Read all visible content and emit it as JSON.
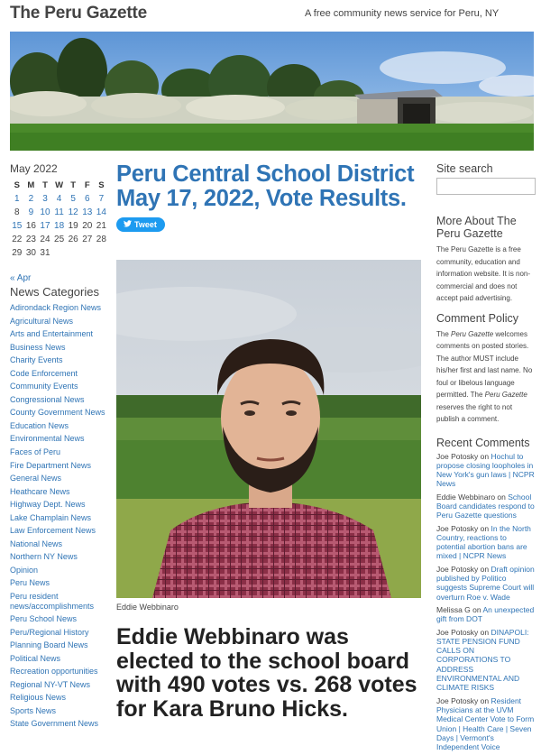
{
  "site": {
    "title": "The Peru Gazette",
    "tagline": "A free community news service for Peru, NY"
  },
  "calendar": {
    "title": "May 2022",
    "weekdays": [
      "S",
      "M",
      "T",
      "W",
      "T",
      "F",
      "S"
    ],
    "weeks": [
      [
        {
          "d": "1",
          "link": true
        },
        {
          "d": "2",
          "link": true
        },
        {
          "d": "3",
          "link": true
        },
        {
          "d": "4",
          "link": true
        },
        {
          "d": "5",
          "link": true
        },
        {
          "d": "6",
          "link": true
        },
        {
          "d": "7",
          "link": true
        }
      ],
      [
        {
          "d": "8",
          "link": false
        },
        {
          "d": "9",
          "link": true
        },
        {
          "d": "10",
          "link": true
        },
        {
          "d": "11",
          "link": true
        },
        {
          "d": "12",
          "link": true
        },
        {
          "d": "13",
          "link": true
        },
        {
          "d": "14",
          "link": true
        }
      ],
      [
        {
          "d": "15",
          "link": true
        },
        {
          "d": "16",
          "link": false
        },
        {
          "d": "17",
          "link": true
        },
        {
          "d": "18",
          "link": true
        },
        {
          "d": "19",
          "link": false
        },
        {
          "d": "20",
          "link": false
        },
        {
          "d": "21",
          "link": false
        }
      ],
      [
        {
          "d": "22",
          "link": false
        },
        {
          "d": "23",
          "link": false
        },
        {
          "d": "24",
          "link": false
        },
        {
          "d": "25",
          "link": false
        },
        {
          "d": "26",
          "link": false
        },
        {
          "d": "27",
          "link": false
        },
        {
          "d": "28",
          "link": false
        }
      ],
      [
        {
          "d": "29",
          "link": false
        },
        {
          "d": "30",
          "link": false
        },
        {
          "d": "31",
          "link": false
        },
        {
          "d": "",
          "link": false
        },
        {
          "d": "",
          "link": false
        },
        {
          "d": "",
          "link": false
        },
        {
          "d": "",
          "link": false
        }
      ]
    ],
    "prev_link": "« Apr"
  },
  "categories": {
    "title": "News Categories",
    "items": [
      "Adirondack Region News",
      "Agricultural News",
      "Arts and Entertainment",
      "Business News",
      "Charity Events",
      "Code Enforcement",
      "Community Events",
      "Congressional News",
      "County Government News",
      "Education News",
      "Environmental News",
      "Faces of Peru",
      "Fire Department News",
      "General News",
      "Heathcare News",
      "Highway Dept. News",
      "Lake Champlain News",
      "Law Enforcement News",
      "National News",
      "Northern NY News",
      "Opinion",
      "Peru News",
      "Peru resident news/accomplishments",
      "Peru School News",
      "Peru/Regional History",
      "Planning Board News",
      "Political News",
      "Recreation opportunities",
      "Regional NY-VT News",
      "Religious News",
      "Sports News",
      "State Government News"
    ]
  },
  "post": {
    "title": "Peru Central School District May 17, 2022, Vote Results.",
    "tweet_label": "Tweet",
    "photo_caption": "Eddie Webbinaro",
    "headline": "Eddie Webbinaro was elected to the school board with 490 votes vs. 268 votes for Kara Bruno Hicks."
  },
  "sidebar": {
    "search_title": "Site search",
    "search_placeholder": "",
    "about_title": "More About The Peru Gazette",
    "about_text": "The Peru Gazette is a free community, education and information website. It is non-commercial and does not accept paid advertising.",
    "policy_title": "Comment Policy",
    "policy_text_1": "The ",
    "policy_em_1": "Peru Gazette",
    "policy_text_2": " welcomes comments on posted stories. The author MUST include his/her first and last name. No  foul or libelous language permitted. The ",
    "policy_em_2": "Peru Gazette",
    "policy_text_3": " reserves the right to not publish a comment.",
    "recent_title": "Recent Comments",
    "recent": [
      {
        "author": "Joe Potosky",
        "on": " on ",
        "post": "Hochul to propose closing loopholes in New York's gun laws | NCPR News"
      },
      {
        "author": "Eddie Webbinaro",
        "on": " on ",
        "post": "School Board candidates respond to Peru Gazette questions"
      },
      {
        "author": "Joe Potosky",
        "on": " on ",
        "post": "In the North Country, reactions to potential abortion bans are mixed | NCPR News"
      },
      {
        "author": "Joe Potosky",
        "on": " on ",
        "post": "Draft opinion published by Politico suggests Supreme Court will overturn Roe v. Wade"
      },
      {
        "author": "Melissa G",
        "on": " on ",
        "post": "An unexpected gift from DOT"
      },
      {
        "author": "Joe Potosky",
        "on": " on ",
        "post": "DINAPOLI: STATE PENSION FUND CALLS ON CORPORATIONS TO ADDRESS ENVIRONMENTAL AND CLIMATE RISKS"
      },
      {
        "author": "Joe Potosky",
        "on": " on ",
        "post": "Resident Physicians at the UVM Medical Center Vote to Form Union | Health Care | Seven Days | Vermont's Independent Voice"
      }
    ]
  },
  "colors": {
    "link": "#2f74b5",
    "title": "#2f74b5",
    "tweet": "#1d9bf0"
  },
  "icons": {
    "tweet": "bird-icon"
  }
}
